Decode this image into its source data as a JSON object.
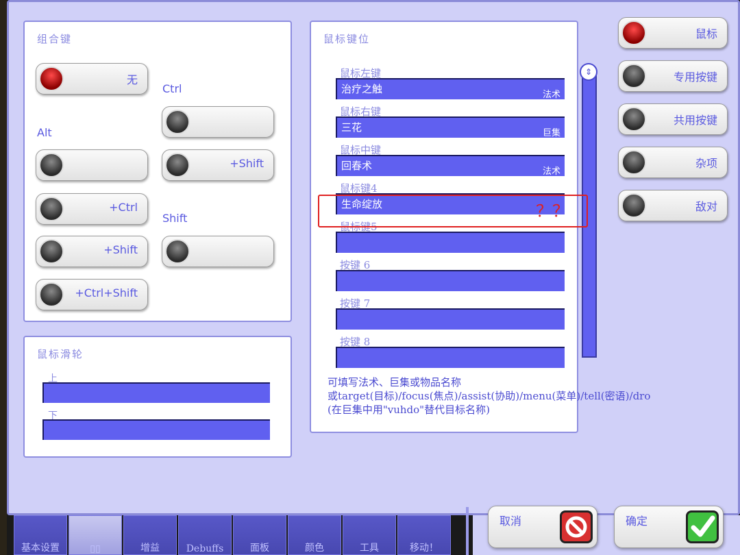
{
  "combo": {
    "title": "组合键",
    "none_label": "无",
    "ctrl_caption": "Ctrl",
    "alt_caption": "Alt",
    "shift_caption": "Shift",
    "ctrl_shift_label": "+Shift",
    "alt_ctrl_label": "+Ctrl",
    "alt_shift_label": "+Shift",
    "alt_ctrl_shift_label": "+Ctrl+Shift"
  },
  "wheel": {
    "title": "鼠标滑轮",
    "up_label": "上",
    "down_label": "下"
  },
  "mouse": {
    "title": "鼠标键位",
    "slots": [
      {
        "label": "鼠标左键",
        "value": "治疗之触",
        "type": "法术"
      },
      {
        "label": "鼠标右键",
        "value": "三花",
        "type": "巨集"
      },
      {
        "label": "鼠标中键",
        "value": "回春术",
        "type": "法术"
      },
      {
        "label": "鼠标键4",
        "value": "生命绽放",
        "type": ""
      },
      {
        "label": "鼠标键5",
        "value": "",
        "type": ""
      },
      {
        "label": "按键 6",
        "value": "",
        "type": ""
      },
      {
        "label": "按键 7",
        "value": "",
        "type": ""
      },
      {
        "label": "按键 8",
        "value": "",
        "type": ""
      }
    ],
    "help_line1": "可填写法术、巨集或物品名称",
    "help_line2": "或target(目标)/focus(焦点)/assist(协助)/menu(菜单)/tell(密语)/dro",
    "help_line3": "(在巨集中用\"vuhdo\"替代目标名称)",
    "annotation": "？？"
  },
  "sidebar": {
    "items": [
      "鼠标",
      "专用按键",
      "共用按键",
      "杂项",
      "敌对"
    ]
  },
  "tabs": [
    "基本设置",
    "▯▯",
    "增益",
    "Debuffs",
    "面板",
    "颜色",
    "工具",
    "移动！"
  ],
  "buttons": {
    "cancel": "取消",
    "ok": "确定"
  }
}
